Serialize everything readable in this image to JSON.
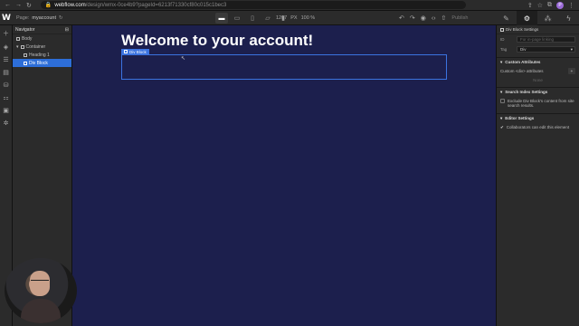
{
  "browser": {
    "url_domain": "webflow.com",
    "url_path": "/design/wmx-0ce4b9?pageId=6213f71330cf80c015c1bec3",
    "profile_initial": "P"
  },
  "designer": {
    "logo": "W",
    "page_label": "Page:",
    "page_name": "myaccount",
    "width_value": "1207",
    "width_unit": "PX",
    "zoom": "100 %",
    "publish_label": "Publish"
  },
  "navigator": {
    "title": "Navigator",
    "items": [
      {
        "label": "Body",
        "indent": 0
      },
      {
        "label": "Container",
        "indent": 1
      },
      {
        "label": "Heading 1",
        "indent": 2
      },
      {
        "label": "Div Block",
        "indent": 2
      }
    ]
  },
  "canvas": {
    "heading": "Welcome to your account!",
    "selected_tag": "Div Block",
    "bg_color": "#1c1f4d",
    "accent": "#3b73e0"
  },
  "settings": {
    "title": "Div Block Settings",
    "id_label": "ID",
    "id_placeholder": "For in-page linking",
    "tag_label": "Tag",
    "tag_value": "Div",
    "custom_attributes_title": "Custom Attributes",
    "custom_attributes_label": "Custom <div> attributes",
    "custom_attributes_empty": "None",
    "search_index_title": "Search Index Settings",
    "search_index_text": "Exclude Div Block's content from site search results.",
    "editor_title": "Editor Settings",
    "editor_text": "Collaborators can edit this element"
  }
}
